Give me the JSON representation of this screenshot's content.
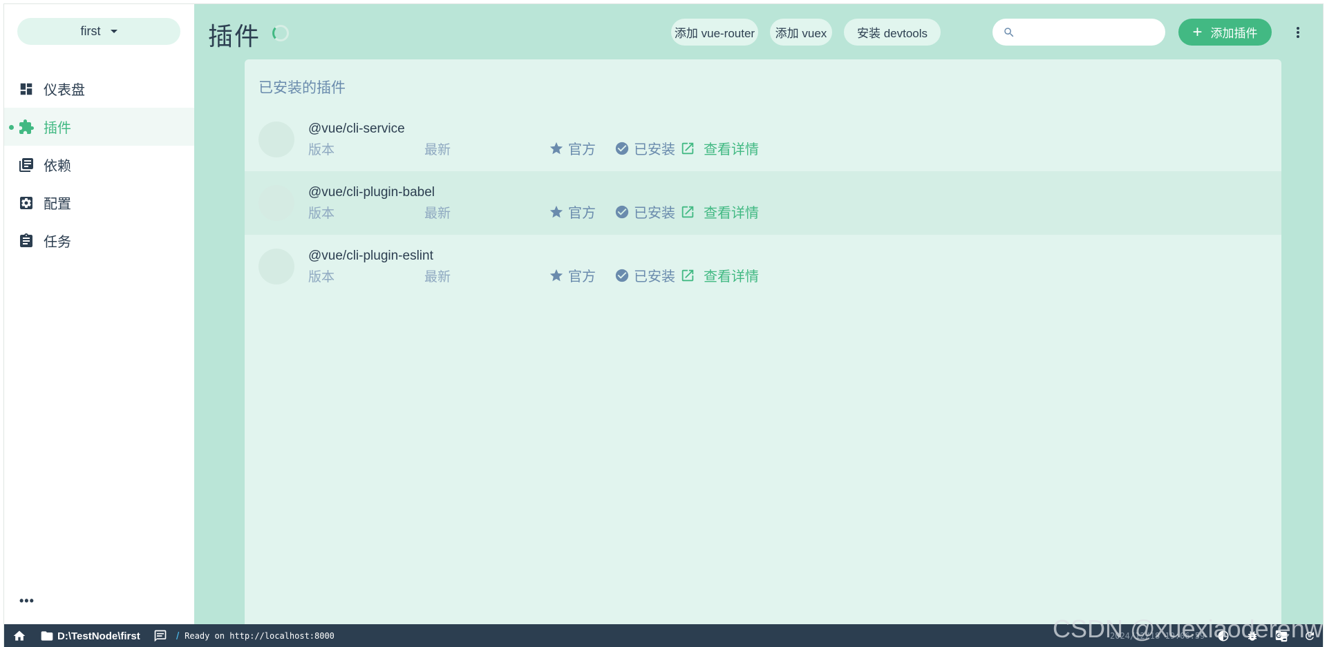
{
  "sidebar": {
    "project_name": "first",
    "items": [
      {
        "label": "仪表盘",
        "icon": "dashboard-icon",
        "active": false
      },
      {
        "label": "插件",
        "icon": "puzzle-icon",
        "active": true
      },
      {
        "label": "依赖",
        "icon": "library-icon",
        "active": false
      },
      {
        "label": "配置",
        "icon": "settings-box-icon",
        "active": false
      },
      {
        "label": "任务",
        "icon": "clipboard-icon",
        "active": false
      }
    ],
    "more_label": "•••"
  },
  "header": {
    "title": "插件",
    "add_router_label": "添加 vue-router",
    "add_vuex_label": "添加 vuex",
    "install_devtools_label": "安装 devtools",
    "search_value": "",
    "search_placeholder": "",
    "add_plugin_label": "添加插件"
  },
  "main": {
    "section_title": "已安装的插件",
    "plugins": [
      {
        "name": "@vue/cli-service",
        "version_label": "版本",
        "latest_label": "最新",
        "official_label": "官方",
        "installed_label": "已安装",
        "details_label": "查看详情",
        "hovered": false
      },
      {
        "name": "@vue/cli-plugin-babel",
        "version_label": "版本",
        "latest_label": "最新",
        "official_label": "官方",
        "installed_label": "已安装",
        "details_label": "查看详情",
        "hovered": true
      },
      {
        "name": "@vue/cli-plugin-eslint",
        "version_label": "版本",
        "latest_label": "最新",
        "official_label": "官方",
        "installed_label": "已安装",
        "details_label": "查看详情",
        "hovered": false
      }
    ]
  },
  "statusbar": {
    "path": "D:\\TestNode\\first",
    "log": "Ready on http://localhost:8000",
    "time": "2024/12/18 19:06:59"
  },
  "watermark": "CSDN @xuexiaoderenwu",
  "colors": {
    "accent": "#42b983",
    "text": "#2c3e50",
    "muted": "#6a8bad",
    "main_bg": "#bae5d7",
    "card_bg": "#e1f4ee",
    "statusbar_bg": "#2c3e50"
  }
}
